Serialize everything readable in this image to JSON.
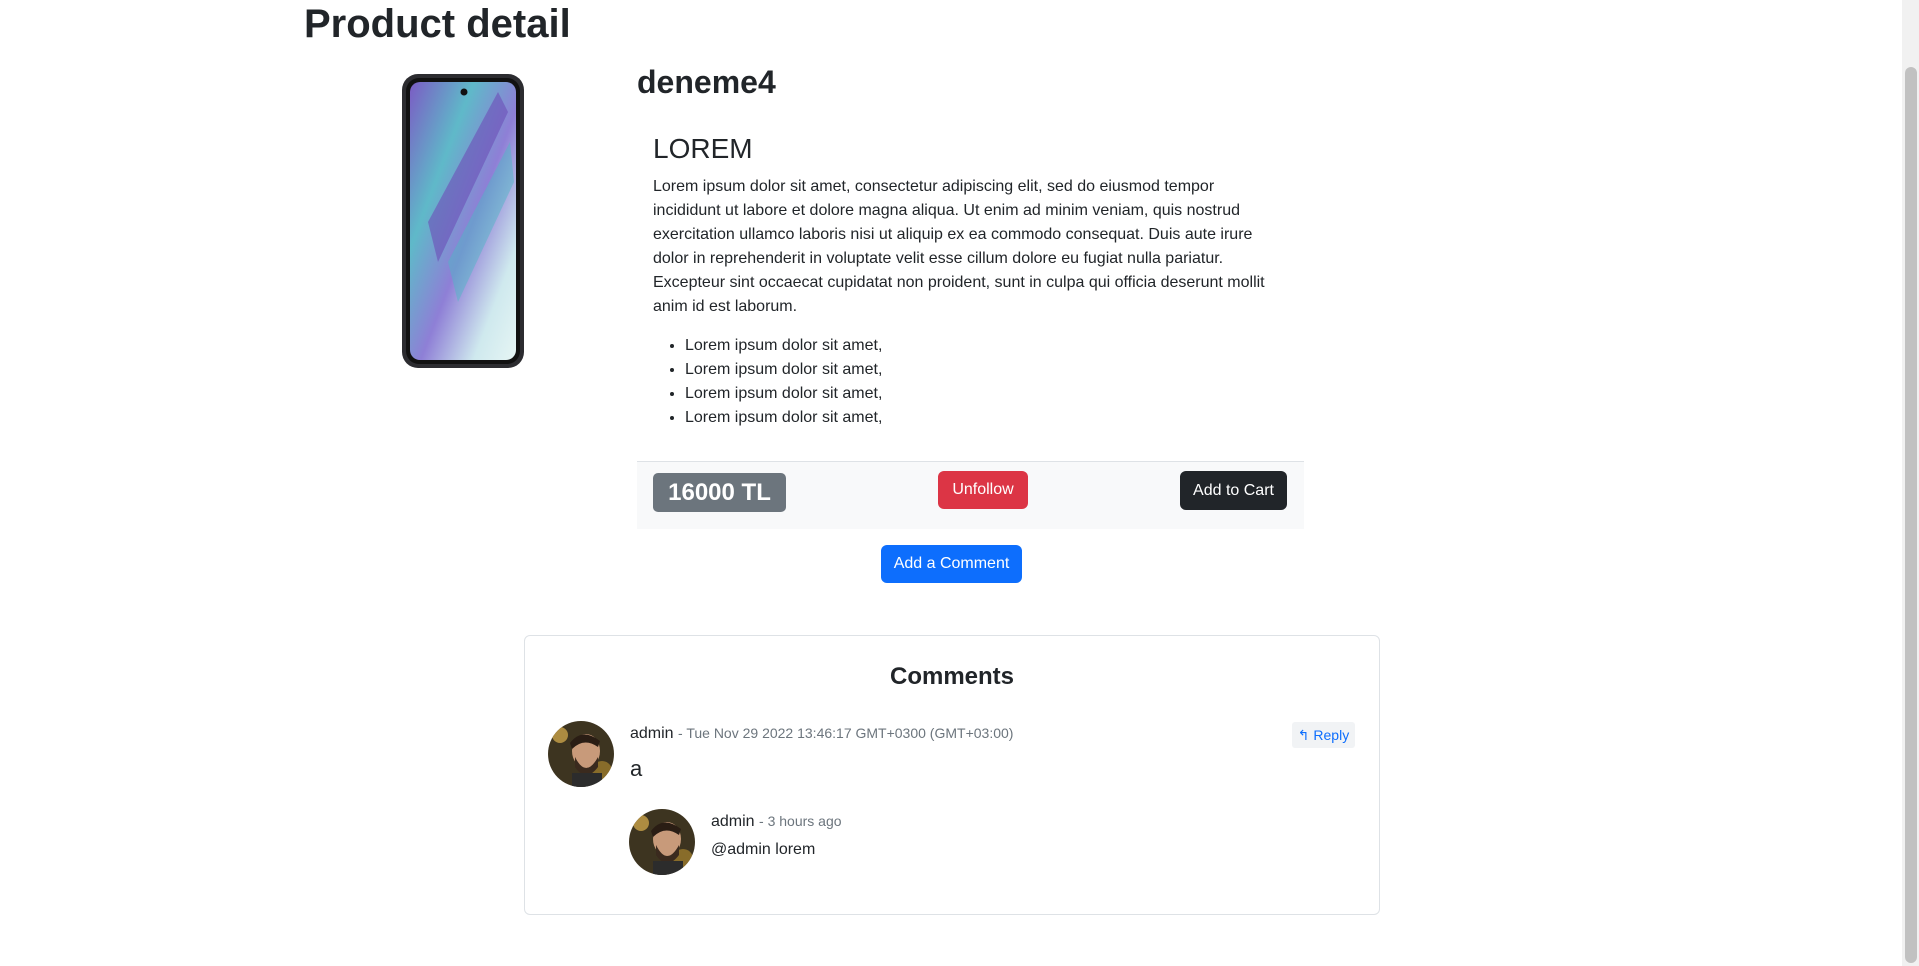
{
  "page": {
    "title": "Product detail"
  },
  "product": {
    "name": "deneme4",
    "image_alt": "phone",
    "description": {
      "heading": "LOREM",
      "paragraph": "Lorem ipsum dolor sit amet, consectetur adipiscing elit, sed do eiusmod tempor incididunt ut labore et dolore magna aliqua. Ut enim ad minim veniam, quis nostrud exercitation ullamco laboris nisi ut aliquip ex ea commodo consequat. Duis aute irure dolor in reprehenderit in voluptate velit esse cillum dolore eu fugiat nulla pariatur. Excepteur sint occaecat cupidatat non proident, sunt in culpa qui officia deserunt mollit anim id est laborum.",
      "list": [
        "Lorem ipsum dolor sit amet,",
        "Lorem ipsum dolor sit amet,",
        "Lorem ipsum dolor sit amet,",
        "Lorem ipsum dolor sit amet,"
      ]
    },
    "price": "16000 TL",
    "unfollow_label": "Unfollow",
    "add_to_cart_label": "Add to Cart"
  },
  "add_comment_label": "Add a Comment",
  "comments": {
    "title": "Comments",
    "items": [
      {
        "author": "admin",
        "date": "- Tue Nov 29 2022 13:46:17 GMT+0300 (GMT+03:00)",
        "text": "a",
        "reply_label": "Reply",
        "replies": [
          {
            "author": "admin",
            "date": "- 3 hours ago",
            "text": "@admin lorem"
          }
        ]
      }
    ]
  },
  "colors": {
    "primary": "#0d6efd",
    "danger": "#dc3545",
    "dark": "#212529",
    "secondary": "#6c757d"
  },
  "icons": {
    "reply": "reply-arrow-icon"
  }
}
